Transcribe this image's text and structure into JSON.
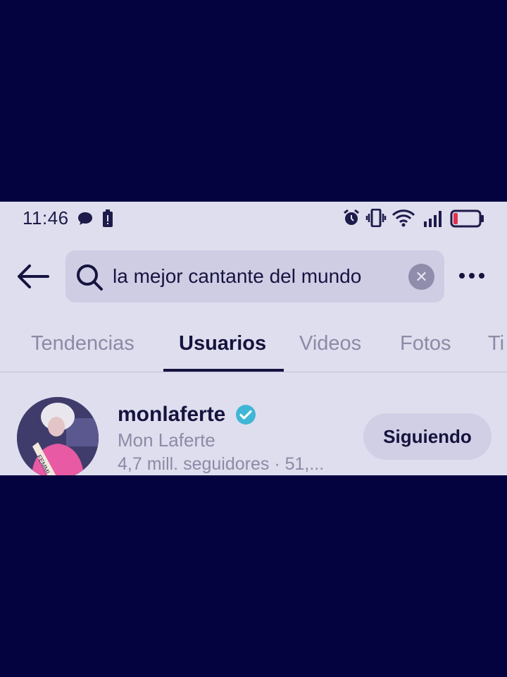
{
  "status_bar": {
    "time": "11:46",
    "icons": [
      "chat-bubble-icon",
      "battery-saver-icon",
      "alarm-icon",
      "vibrate-icon",
      "wifi-icon",
      "signal-icon",
      "battery-icon"
    ],
    "battery_level": 0.1
  },
  "search": {
    "query": "la mejor cantante del mundo",
    "back_icon": "arrow-left-icon",
    "search_icon": "search-icon",
    "clear_icon": "clear-icon",
    "more_icon": "more-icon"
  },
  "tabs": [
    {
      "label": "Tendencias",
      "active": false
    },
    {
      "label": "Usuarios",
      "active": true
    },
    {
      "label": "Videos",
      "active": false
    },
    {
      "label": "Fotos",
      "active": false
    },
    {
      "label": "Ti",
      "active": false
    }
  ],
  "results": [
    {
      "username": "monlaferte",
      "verified": true,
      "display_name": "Mon Laferte",
      "meta": "4,7 mill. seguidores · 51,...",
      "follow_label": "Siguiendo",
      "avatar_sash_text": "FEMMI"
    }
  ],
  "colors": {
    "letterbox": "#05033f",
    "background": "#dfdeee",
    "text": "#15133e",
    "muted": "#8c8aa6",
    "verified": "#3fb6d6",
    "battery_low": "#e2324c"
  }
}
